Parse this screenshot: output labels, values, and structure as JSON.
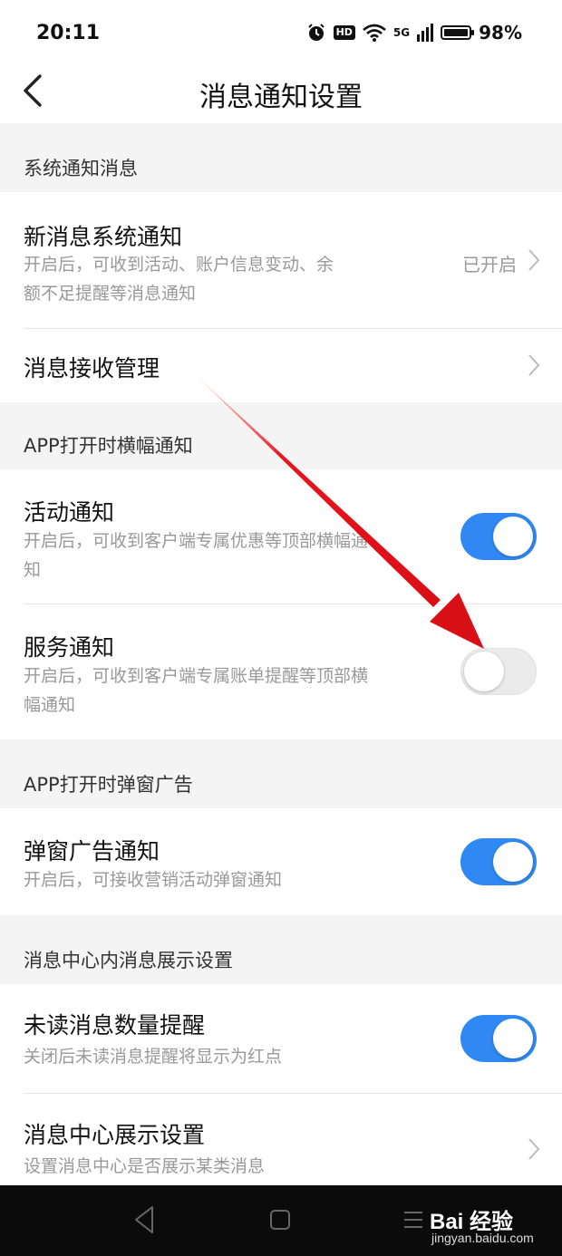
{
  "status_bar": {
    "time": "20:11",
    "hd": "HD",
    "network": "5G",
    "battery": "98%",
    "battery_level": 0.98
  },
  "header": {
    "title": "消息通知设置"
  },
  "sections": [
    {
      "title": "系统通知消息",
      "rows": [
        {
          "title": "新消息系统通知",
          "desc": "开启后，可收到活动、账户信息变动、余额不足提醒等消息通知",
          "status": "已开启"
        },
        {
          "title": "消息接收管理"
        }
      ]
    },
    {
      "title": "APP打开时横幅通知",
      "rows": [
        {
          "title": "活动通知",
          "desc": "开启后，可收到客户端专属优惠等顶部横幅通知",
          "toggle": true
        },
        {
          "title": "服务通知",
          "desc": "开启后，可收到客户端专属账单提醒等顶部横幅通知",
          "toggle": false
        }
      ]
    },
    {
      "title": "APP打开时弹窗广告",
      "rows": [
        {
          "title": "弹窗广告通知",
          "desc": "开启后，可接收营销活动弹窗通知",
          "toggle": true
        }
      ]
    },
    {
      "title": "消息中心内消息展示设置",
      "rows": [
        {
          "title": "未读消息数量提醒",
          "desc": "关闭后未读消息提醒将显示为红点",
          "toggle": true
        },
        {
          "title": "消息中心展示设置",
          "desc": "设置消息中心是否展示某类消息"
        }
      ]
    }
  ],
  "watermark": {
    "logo": "Bai 经验",
    "url": "jingyan.baidu.com"
  },
  "colors": {
    "accent": "#2f88f3",
    "arrow": "#e8141b"
  }
}
